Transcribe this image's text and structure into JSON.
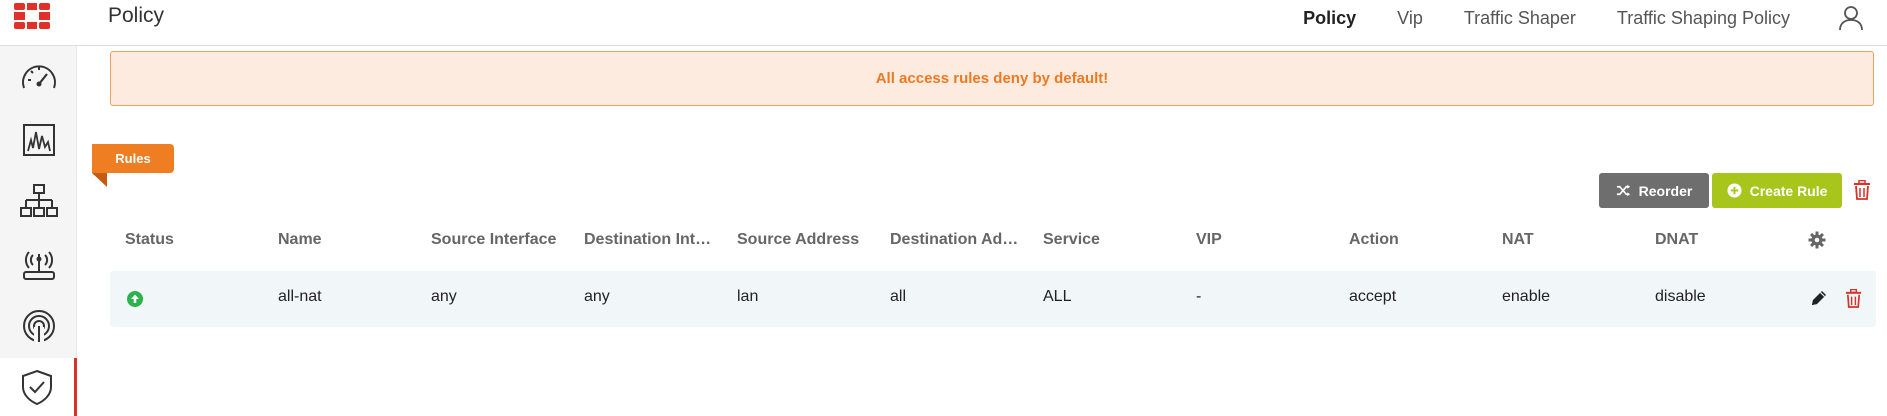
{
  "header": {
    "page_title": "Policy",
    "nav": [
      {
        "label": "Policy",
        "active": true
      },
      {
        "label": "Vip",
        "active": false
      },
      {
        "label": "Traffic Shaper",
        "active": false
      },
      {
        "label": "Traffic Shaping Policy",
        "active": false
      }
    ],
    "icons": {
      "logo": "fortinet-logo-icon",
      "user": "user-icon"
    }
  },
  "sidebar": {
    "items": [
      {
        "icon": "dashboard-gauge-icon",
        "active": false
      },
      {
        "icon": "monitor-chart-icon",
        "active": false
      },
      {
        "icon": "network-topology-icon",
        "active": false
      },
      {
        "icon": "wifi-router-icon",
        "active": false
      },
      {
        "icon": "wireless-signal-icon",
        "active": false
      },
      {
        "icon": "security-shield-icon",
        "active": true
      }
    ]
  },
  "alert": {
    "message": "All access rules deny by default!"
  },
  "section": {
    "ribbon_label": "Rules"
  },
  "toolbar": {
    "reorder_label": "Reorder",
    "create_label": "Create Rule"
  },
  "table": {
    "columns": [
      "Status",
      "Name",
      "Source Interface",
      "Destination Int…",
      "Source Address",
      "Destination Ad…",
      "Service",
      "VIP",
      "Action",
      "NAT",
      "DNAT"
    ],
    "rows": [
      {
        "status": "enabled",
        "name": "all-nat",
        "source_interface": "any",
        "destination_interface": "any",
        "source_address": "lan",
        "destination_address": "all",
        "service": "ALL",
        "vip": "-",
        "action": "accept",
        "nat": "enable",
        "dnat": "disable"
      }
    ]
  },
  "colors": {
    "accent_orange": "#ef7d22",
    "create_green": "#a8c51c",
    "reorder_gray": "#6e6e6e",
    "danger_red": "#d9312b",
    "status_green": "#2bb24c",
    "alert_bg": "#fdebe0"
  }
}
